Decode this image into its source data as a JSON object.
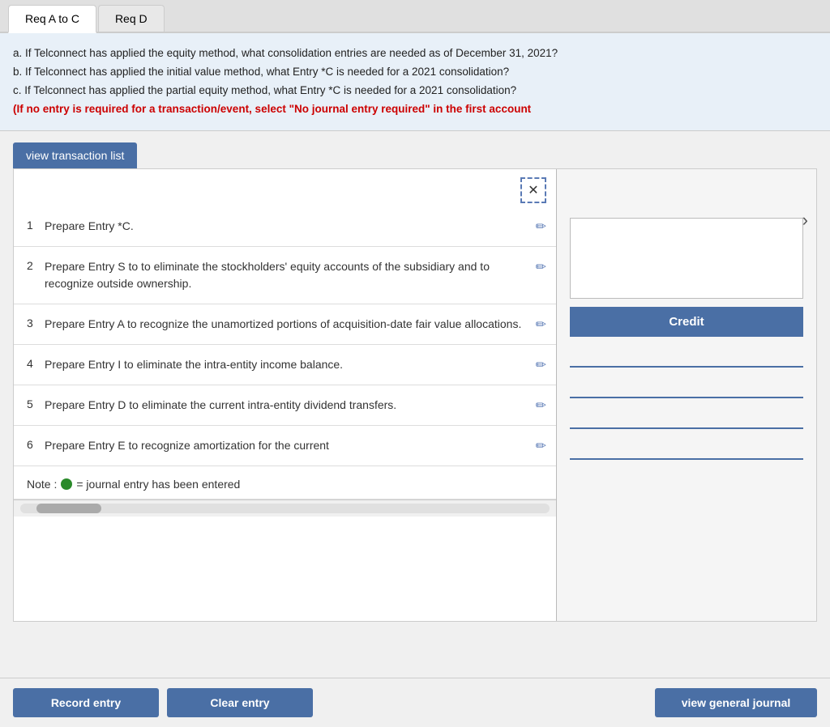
{
  "tabs": [
    {
      "id": "req-a-c",
      "label": "Req A to C",
      "active": true
    },
    {
      "id": "req-d",
      "label": "Req D",
      "active": false
    }
  ],
  "instructions": {
    "line1": "a. If Telconnect has applied the equity method, what consolidation entries are needed as of December 31, 2021?",
    "line2": "b. If Telconnect has applied the initial value method, what Entry *C is needed for a 2021 consolidation?",
    "line3": "c. If Telconnect has applied the partial equity method, what Entry *C is needed for a 2021 consolidation?",
    "warning": "(If no entry is required for a transaction/event, select \"No journal entry required\" in the first account"
  },
  "view_transaction_btn": "view transaction list",
  "transactions": [
    {
      "number": 1,
      "text": "Prepare Entry *C."
    },
    {
      "number": 2,
      "text": "Prepare Entry S to to eliminate the stockholders' equity accounts of the subsidiary and to recognize outside ownership."
    },
    {
      "number": 3,
      "text": "Prepare Entry A to recognize the unamortized portions of acquisition-date fair value allocations."
    },
    {
      "number": 4,
      "text": "Prepare Entry I to eliminate the intra-entity income balance."
    },
    {
      "number": 5,
      "text": "Prepare Entry D to eliminate the current intra-entity dividend transfers."
    },
    {
      "number": 6,
      "text": "Prepare Entry E to recognize amortization for the current"
    }
  ],
  "note_text": "= journal entry has been entered",
  "credit_label": "Credit",
  "buttons": {
    "record_entry": "Record entry",
    "clear_entry": "Clear entry",
    "view_general_journal": "view general journal"
  },
  "icons": {
    "close": "✕",
    "edit": "✏",
    "chevron_right": "›"
  }
}
